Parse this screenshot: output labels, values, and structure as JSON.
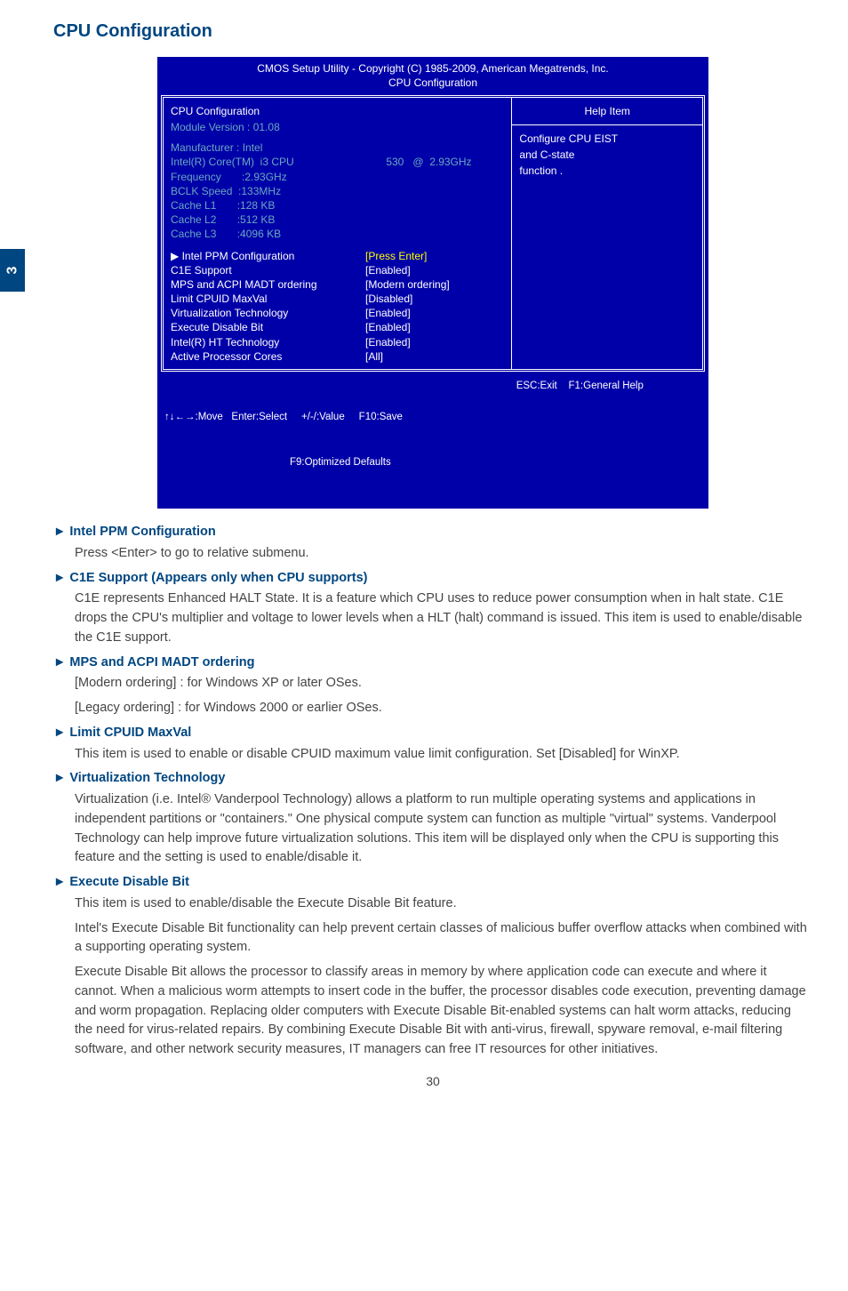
{
  "sideTab": "3",
  "pageTitle": "CPU Configuration",
  "bios": {
    "header1": "CMOS Setup Utility - Copyright (C) 1985-2009, American Megatrends, Inc.",
    "header2": "CPU Configuration",
    "leftTitle": "CPU Configuration",
    "moduleVersion": "Module Version :  01.08",
    "info": {
      "manufacturer_l": "Manufacturer : Intel",
      "cpu_l": "Intel(R) Core(TM)  i3 CPU",
      "cpu_v": "       530   @  2.93GHz",
      "freq_l": "Frequency       :2.93GHz",
      "bclk_l": "BCLK Speed  :133MHz",
      "l1_l": "Cache L1       :128 KB",
      "l2_l": "Cache L2       :512 KB",
      "l3_l": "Cache L3       :4096 KB"
    },
    "settings": {
      "ppm_l": "▶ Intel PPM Configuration",
      "ppm_v": "[Press Enter]",
      "c1e_l": "C1E Support",
      "c1e_v": "[Enabled]",
      "mps_l": "MPS and ACPI MADT ordering",
      "mps_v": "[Modern ordering]",
      "cpuid_l": "Limit CPUID MaxVal",
      "cpuid_v": "[Disabled]",
      "virt_l": "Virtualization Technology",
      "virt_v": "[Enabled]",
      "exec_l": "Execute Disable Bit",
      "exec_v": "[Enabled]",
      "ht_l": "Intel(R) HT Technology",
      "ht_v": "[Enabled]",
      "cores_l": "Active Processor Cores",
      "cores_v": "[All]"
    },
    "help": {
      "title": "Help Item",
      "text1": "Configure CPU EIST",
      "text2": "and C-state",
      "text3": "function ."
    },
    "footerLeft": "↑↓←→:Move   Enter:Select     +/-/:Value     F10:Save",
    "footerLeft2": "F9:Optimized Defaults",
    "footerRight": "ESC:Exit    F1:General Help"
  },
  "sections": {
    "ppm": {
      "head": "Intel PPM Configuration",
      "body": "Press <Enter> to go to relative submenu."
    },
    "c1e": {
      "head": "C1E Support (Appears only when CPU supports)",
      "body": "C1E represents Enhanced HALT State. It is a feature which CPU uses to reduce power consumption when in halt state. C1E drops the CPU's multiplier and voltage to lower levels when a HLT (halt) command is issued. This item is used to enable/disable the C1E support."
    },
    "mps": {
      "head": "MPS and ACPI MADT ordering",
      "body1": "[Modern ordering] : for Windows XP or later OSes.",
      "body2": "[Legacy ordering] : for Windows 2000 or earlier OSes."
    },
    "cpuid": {
      "head": "Limit CPUID MaxVal",
      "body": "This item is used to enable or disable CPUID maximum value limit configuration. Set [Disabled] for WinXP."
    },
    "virt": {
      "head": "Virtualization Technology",
      "body": "Virtualization (i.e. Intel® Vanderpool Technology) allows a platform to run multiple operating systems and applications in independent partitions or \"containers.\" One physical compute system can function as multiple \"virtual\" systems. Vanderpool Technology can help improve future virtualization solutions. This item will be displayed only when the CPU is supporting this feature and the setting is used to enable/disable it."
    },
    "exec": {
      "head": "Execute Disable Bit",
      "body1": "This item is used to enable/disable the Execute Disable Bit feature.",
      "body2": "Intel's Execute Disable Bit functionality can help prevent certain classes of malicious buffer overflow attacks when combined with a supporting operating system.",
      "body3": "Execute Disable Bit allows the processor to classify areas in memory by where application code can execute and where it cannot. When a malicious worm attempts to insert code in the buffer, the processor disables code execution, preventing damage and worm propagation. Replacing older computers with Execute Disable Bit-enabled systems can halt worm attacks, reducing the need for virus-related repairs. By combining Execute Disable Bit with anti-virus, firewall, spyware removal, e-mail filtering software, and other network security measures, IT managers can free IT resources for other initiatives."
    }
  },
  "pageNumber": "30"
}
